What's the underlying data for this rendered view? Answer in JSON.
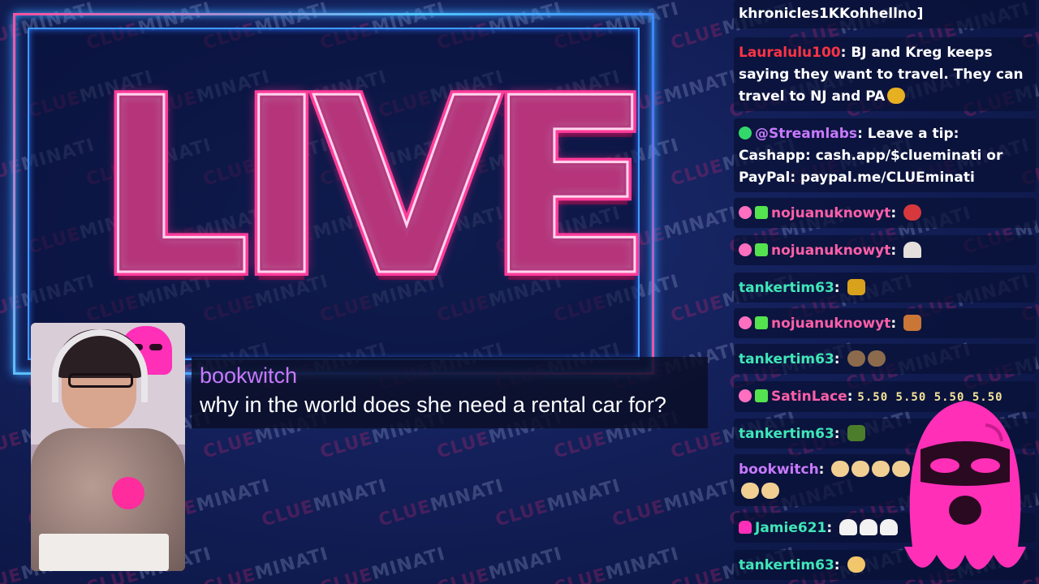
{
  "watermark": {
    "part_a": "CLUE",
    "part_b": "MINATI"
  },
  "live": {
    "text": "LIVE"
  },
  "caption": {
    "username": "bookwitch",
    "message": "why in the world does she need a rental car for?"
  },
  "chat": {
    "messages": [
      {
        "user": "",
        "text": "khronicles1KKohhellno]",
        "user_color": "#ffffff",
        "badges": [],
        "emotes": []
      },
      {
        "user": "Lauralulu100",
        "text": "BJ and Kreg keeps saying they want to travel. They can travel to NJ and PA",
        "user_color": "#ff3344",
        "badges": [],
        "emotes": [
          "e-hat"
        ]
      },
      {
        "user": "@Streamlabs",
        "text": "Leave a tip: Cashapp: cash.app/$clueminati or PayPal: paypal.me/CLUEminati",
        "user_color": "#c879ff",
        "badges": [
          "check"
        ],
        "emotes": []
      },
      {
        "user": "nojuanuknowyt",
        "text": "",
        "user_color": "#ff5fa8",
        "badges": [
          "eye",
          "gift"
        ],
        "emotes": [
          "e-red"
        ]
      },
      {
        "user": "nojuanuknowyt",
        "text": "",
        "user_color": "#ff5fa8",
        "badges": [
          "eye",
          "gift"
        ],
        "emotes": [
          "e-pin"
        ]
      },
      {
        "user": "tankertim63",
        "text": "",
        "user_color": "#3fe6b8",
        "badges": [],
        "emotes": [
          "e-gold"
        ]
      },
      {
        "user": "nojuanuknowyt",
        "text": "",
        "user_color": "#ff5fa8",
        "badges": [
          "eye",
          "gift"
        ],
        "emotes": [
          "e-box"
        ]
      },
      {
        "user": "tankertim63",
        "text": "",
        "user_color": "#3fe6b8",
        "badges": [],
        "emotes": [
          "e-bird",
          "e-bird"
        ]
      },
      {
        "user": "SatinLace",
        "text": "5.50 5.50 5.50 5.50",
        "user_color": "#ff5fa8",
        "badges": [
          "eye",
          "gift"
        ],
        "emotes": []
      },
      {
        "user": "tankertim63",
        "text": "",
        "user_color": "#3fe6b8",
        "badges": [],
        "emotes": [
          "e-green"
        ]
      },
      {
        "user": "bookwitch",
        "text": "",
        "user_color": "#c879ff",
        "badges": [],
        "emotes": [
          "e-potato",
          "e-potato",
          "e-potato",
          "e-potato",
          "e-potato",
          "e-potato",
          "e-potato",
          "e-potato",
          "e-potato",
          "e-potato",
          "e-potato"
        ]
      },
      {
        "user": "Jamie621",
        "text": "",
        "user_color": "#3fe6b8",
        "badges": [
          "mask"
        ],
        "emotes": [
          "e-ghost",
          "e-ghost",
          "e-ghost"
        ]
      },
      {
        "user": "tankertim63",
        "text": "",
        "user_color": "#3fe6b8",
        "badges": [],
        "emotes": [
          "e-face"
        ]
      }
    ]
  },
  "colors": {
    "background": "#13205a",
    "neon_pink": "#ff3c9a",
    "neon_blue": "#3c9cff",
    "chat_bg": "#08103a"
  }
}
